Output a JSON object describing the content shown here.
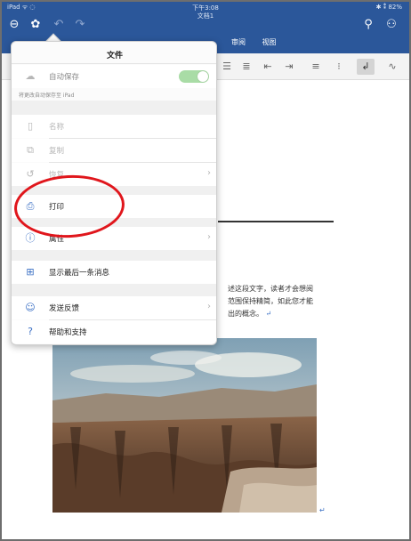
{
  "status_bar": {
    "left": "iPad ᯤ ◌",
    "time": "下午3:08",
    "right": "✱ ⁑ 82%"
  },
  "document": {
    "title": "文档1",
    "body_lines": [
      "述这段文字，读者才会想阅",
      "范围保持精简，如此您才能",
      "出的概念。"
    ],
    "para_mark": "↵"
  },
  "ribbon": {
    "tabs": [
      "审阅",
      "视图"
    ]
  },
  "file_menu": {
    "title": "文件",
    "autosave_label": "自动保存",
    "autosave_on": true,
    "autosave_note": "将更改自动保存至 iPad",
    "items": [
      {
        "label": "名称",
        "icon": "document-icon",
        "enabled": false
      },
      {
        "label": "复制",
        "icon": "copy-icon",
        "enabled": false
      },
      {
        "label": "恢复",
        "icon": "restore-icon",
        "enabled": false,
        "chevron": true
      },
      {
        "label": "打印",
        "icon": "printer-icon",
        "enabled": true
      },
      {
        "label": "属性",
        "icon": "info-icon",
        "enabled": true,
        "chevron": true
      },
      {
        "label": "显示最后一条消息",
        "icon": "last-message-icon",
        "enabled": true
      },
      {
        "label": "发送反馈",
        "icon": "feedback-icon",
        "enabled": true,
        "chevron": true
      },
      {
        "label": "帮助和支持",
        "icon": "help-icon",
        "enabled": true
      }
    ]
  },
  "colors": {
    "header_blue": "#2b579a",
    "annotation_red": "#e0161c",
    "toggle_green": "#a9dca6"
  }
}
